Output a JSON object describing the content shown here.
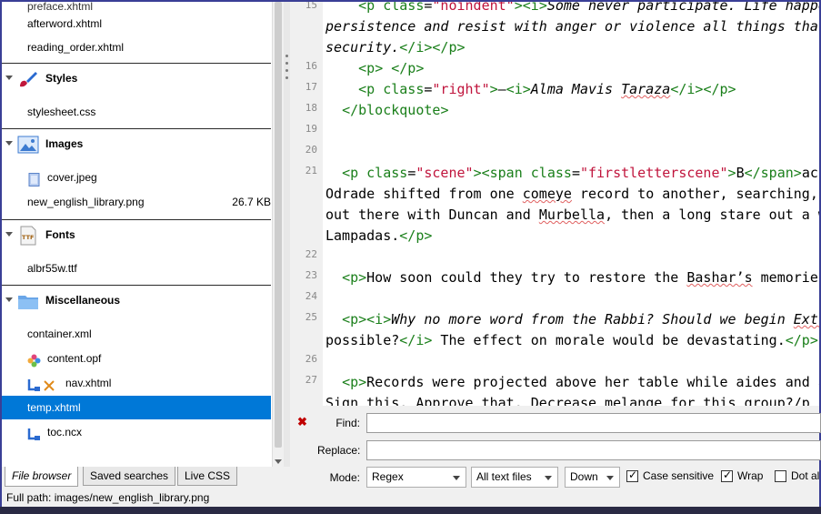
{
  "tree": {
    "rows": [
      {
        "kind": "file",
        "name": "afterword.xhtml"
      },
      {
        "kind": "file",
        "name": "reading_order.xhtml"
      },
      {
        "kind": "group",
        "label": "Styles",
        "icon": "styles-brush-icon"
      },
      {
        "kind": "file",
        "name": "stylesheet.css"
      },
      {
        "kind": "group",
        "label": "Images",
        "icon": "images-icon"
      },
      {
        "kind": "file",
        "name": "cover.jpeg",
        "icon": "cover-image-icon"
      },
      {
        "kind": "file",
        "name": "new_english_library.png",
        "size": "26.7 KB"
      },
      {
        "kind": "group",
        "label": "Fonts",
        "icon": "ttf-font-icon"
      },
      {
        "kind": "file",
        "name": "albr55w.ttf"
      },
      {
        "kind": "group",
        "label": "Miscellaneous",
        "icon": "folder-icon"
      },
      {
        "kind": "file",
        "name": "container.xml"
      },
      {
        "kind": "file",
        "name": "content.opf",
        "icon": "opf-puzzle-icon"
      },
      {
        "kind": "file",
        "name": "nav.xhtml",
        "icon": "nav-icon"
      },
      {
        "kind": "file",
        "name": "temp.xhtml",
        "selected": true
      },
      {
        "kind": "file",
        "name": "toc.ncx",
        "icon": "toc-icon"
      }
    ]
  },
  "panel_tabs": [
    "File browser",
    "Saved searches",
    "Live CSS"
  ],
  "status": {
    "full_path": "Full path: images/new_english_library.png"
  },
  "editor": {
    "line_numbers": [
      "15",
      "16",
      "17",
      "18",
      "19",
      "20",
      "21",
      "22",
      "23",
      "24",
      "25",
      "26",
      "27"
    ],
    "lines": [
      "    <p class=\"noindent\"><i>Some never participate. Life happe",
      "persistence and resist with anger or violence all things tha",
      "security.</i></p>",
      "    <p> </p>",
      "    <p class=\"right\">—<i>Alma Mavis Taraza</i></p>",
      "  </blockquote>",
      "",
      "",
      "  <p class=\"scene\"><span class=\"firstletterscene\">B</span>ac",
      "Odrade shifted from one comeye record to another, searching,",
      "out there with Duncan and Murbella, then a long stare out a w",
      "Lampadas.</p>",
      "",
      "  <p>How soon could they try to restore the Bashar’s memories",
      "",
      "  <p><i>Why no more word from the Rabbi? Should we begin Extr",
      "possible?</i> The effect on morale would be devastating.</p>",
      "",
      "  <p>Records were projected above her table while aides and a",
      "Sign this. Approve that. Decrease melange for this group?</p"
    ]
  },
  "find": {
    "find_label": "Find:",
    "replace_label": "Replace:",
    "mode_label": "Mode:",
    "mode_value": "Regex",
    "scope_value": "All text files",
    "direction_value": "Down",
    "case_sensitive_label": "Case sensitive",
    "case_sensitive": true,
    "wrap_label": "Wrap",
    "wrap": true,
    "dotall_label": "Dot al",
    "dotall": false
  }
}
